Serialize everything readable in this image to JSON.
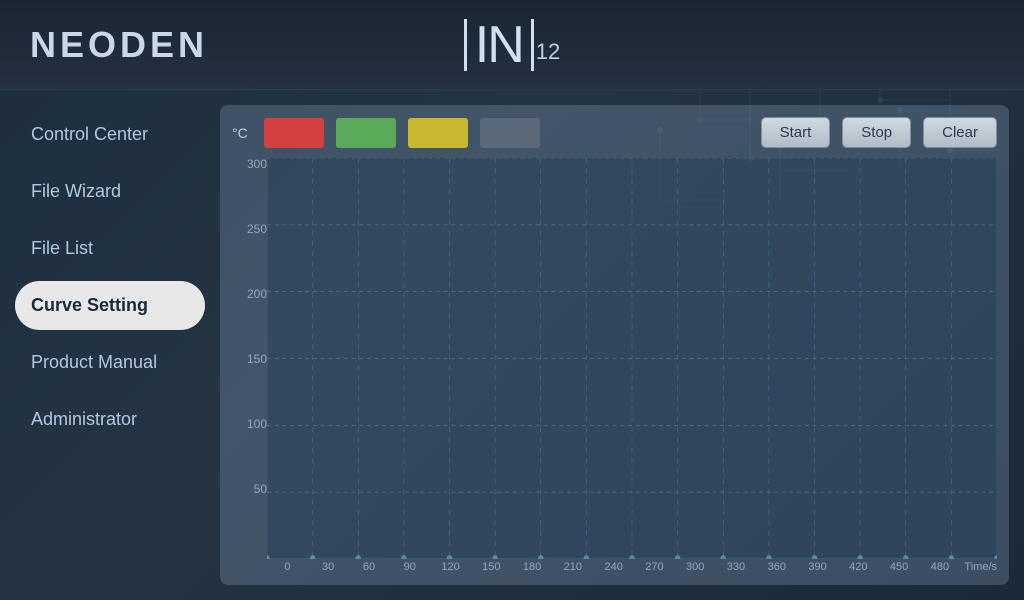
{
  "app": {
    "name": "NEODEN",
    "title_letters": "IN",
    "title_number": "12"
  },
  "sidebar": {
    "items": [
      {
        "id": "control-center",
        "label": "Control Center",
        "active": false
      },
      {
        "id": "file-wizard",
        "label": "File Wizard",
        "active": false
      },
      {
        "id": "file-list",
        "label": "File List",
        "active": false
      },
      {
        "id": "curve-setting",
        "label": "Curve Setting",
        "active": true
      },
      {
        "id": "product-manual",
        "label": "Product Manual",
        "active": false
      },
      {
        "id": "administrator",
        "label": "Administrator",
        "active": false
      }
    ]
  },
  "toolbar": {
    "unit_label": "°C",
    "start_label": "Start",
    "stop_label": "Stop",
    "clear_label": "Clear",
    "swatches": [
      {
        "id": "swatch-red",
        "color": "#d44040"
      },
      {
        "id": "swatch-green",
        "color": "#5aaa5a"
      },
      {
        "id": "swatch-yellow",
        "color": "#c8b830"
      },
      {
        "id": "swatch-gray",
        "color": "#5a6a7a"
      }
    ]
  },
  "chart": {
    "y_labels": [
      "300",
      "250",
      "200",
      "150",
      "100",
      "50",
      ""
    ],
    "x_labels": [
      "0",
      "30",
      "60",
      "90",
      "120",
      "150",
      "180",
      "210",
      "240",
      "270",
      "300",
      "330",
      "360",
      "390",
      "420",
      "450",
      "480"
    ],
    "x_unit": "Time/s"
  },
  "colors": {
    "accent": "#4a8ab0",
    "background": "#1c2d3e",
    "panel": "rgba(160,185,210,0.25)",
    "nav_active_bg": "#e8e8e8",
    "nav_active_text": "#1a2a3a"
  }
}
